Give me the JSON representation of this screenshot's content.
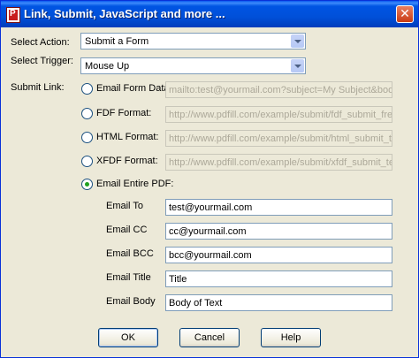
{
  "window": {
    "title": "Link, Submit, JavaScript and more ...",
    "close_glyph": "✕"
  },
  "select_action": {
    "label": "Select Action:",
    "value": "Submit a Form"
  },
  "select_trigger": {
    "label": "Select Trigger:",
    "value": "Mouse Up"
  },
  "submit_link": {
    "label": "Submit Link:",
    "selected": "email_entire_pdf",
    "options": [
      {
        "id": "email_form_data",
        "label": "Email Form Data:",
        "value": "mailto:test@yourmail.com?subject=My Subject&body=Her"
      },
      {
        "id": "fdf_format",
        "label": "FDF Format:",
        "value": "http://www.pdfill.com/example/submit/fdf_submit_free.ph"
      },
      {
        "id": "html_format",
        "label": "HTML Format:",
        "value": "http://www.pdfill.com/example/submit/html_submit_test.p"
      },
      {
        "id": "xfdf_format",
        "label": "XFDF Format:",
        "value": "http://www.pdfill.com/example/submit/xfdf_submit_test.p"
      },
      {
        "id": "email_entire_pdf",
        "label": "Email Entire PDF:"
      }
    ]
  },
  "email_fields": {
    "to": {
      "label": "Email To",
      "value": "test@yourmail.com"
    },
    "cc": {
      "label": "Email CC",
      "value": "cc@yourmail.com"
    },
    "bcc": {
      "label": "Email BCC",
      "value": "bcc@yourmail.com"
    },
    "title": {
      "label": "Email Title",
      "value": "Title"
    },
    "body": {
      "label": "Email Body",
      "value": "Body of Text"
    }
  },
  "buttons": {
    "ok": "OK",
    "cancel": "Cancel",
    "help": "Help"
  }
}
